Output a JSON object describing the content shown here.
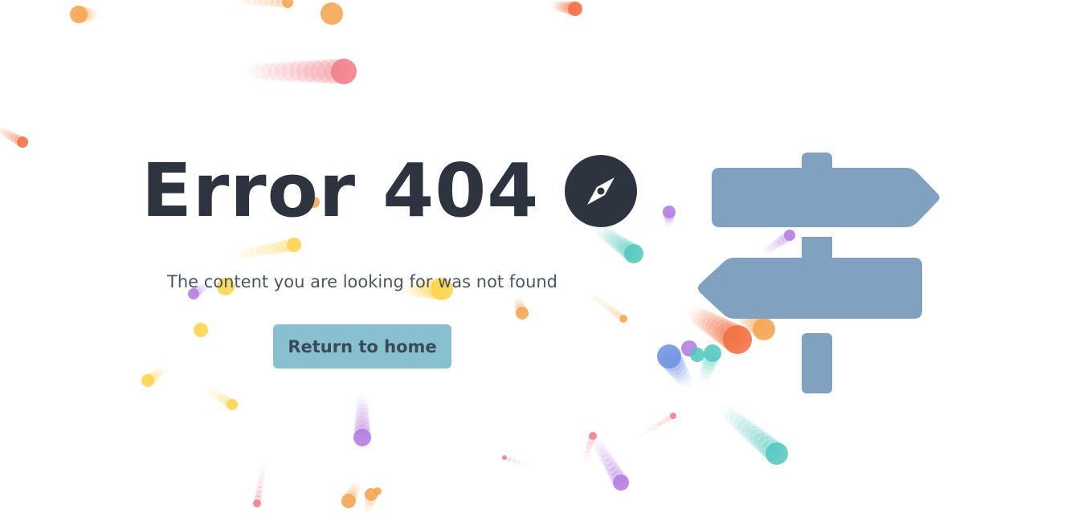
{
  "page": {
    "title": "Error 404",
    "message": "The content you are looking for was not found",
    "home_button_label": "Return to home"
  },
  "icons": {
    "compass": "compass-icon",
    "signpost": "signpost-illustration"
  },
  "colors": {
    "title": "#2d3440",
    "message": "#4b5563",
    "button_bg": "#88c0d0",
    "button_text": "#3b4a5a",
    "signpost": "#81a1c1",
    "confetti": [
      "#f5a14a",
      "#f07985",
      "#f26b3a",
      "#4fc7bd",
      "#b277e0",
      "#fdd246",
      "#6a8ee0"
    ]
  }
}
